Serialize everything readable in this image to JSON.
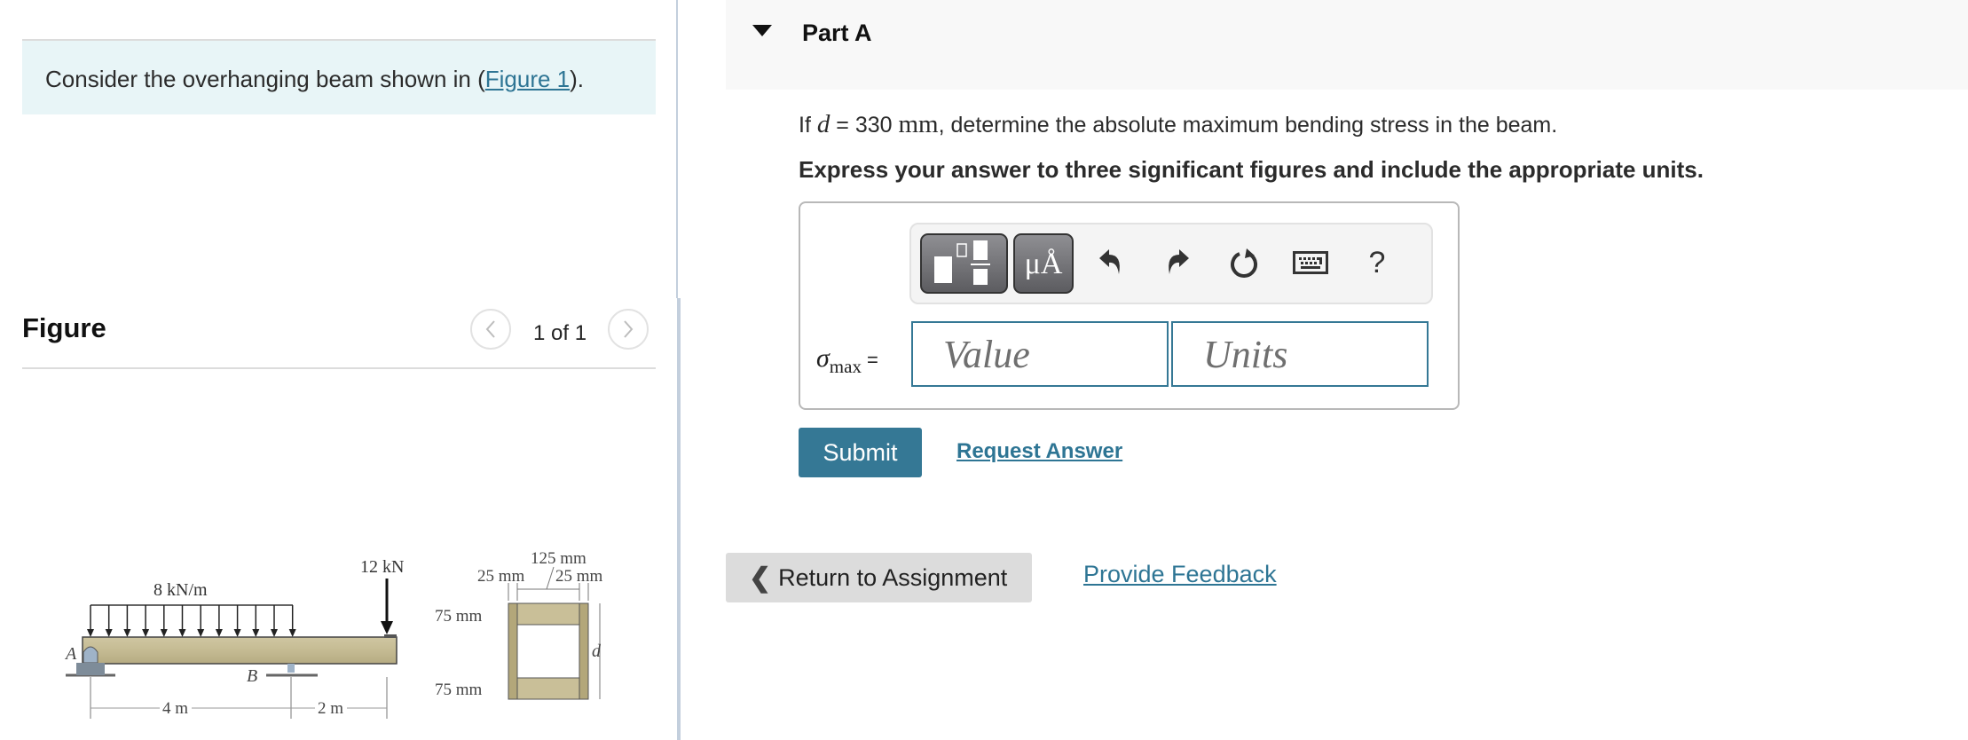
{
  "intro": {
    "prefix": "Consider the overhanging beam shown in (",
    "link_label": "Figure 1",
    "suffix": ")."
  },
  "figure_panel": {
    "title": "Figure",
    "pager_text": "1 of 1",
    "prev_icon": "chevron-left-icon",
    "next_icon": "chevron-right-icon"
  },
  "figure": {
    "distributed_load_label": "8 kN/m",
    "point_load_label": "12 kN",
    "support_a_label": "A",
    "support_b_label": "B",
    "span_ab_label": "4 m",
    "overhang_label": "2 m",
    "section": {
      "inner_width_label": "125 mm",
      "left_side_label": "25 mm",
      "right_side_label": "25 mm",
      "top_flange_label": "75 mm",
      "bottom_flange_label": "75 mm",
      "depth_label": "d"
    }
  },
  "part": {
    "title": "Part A",
    "question_prefix": "If ",
    "question_var": "d",
    "question_eq": " = 330 ",
    "question_unit": "mm",
    "question_suffix": ", determine the absolute maximum bending stress in the beam.",
    "instruction": "Express your answer to three significant figures and include the appropriate units."
  },
  "toolbar": {
    "templates_icon": "templates-icon",
    "units_label": "μÅ",
    "undo_icon": "undo-icon",
    "redo_icon": "redo-icon",
    "reset_icon": "reset-icon",
    "keyboard_icon": "keyboard-icon",
    "help_label": "?"
  },
  "answer": {
    "symbol": "σ",
    "subscript": "max",
    "equals": "=",
    "value_placeholder": "Value",
    "value": "",
    "units_placeholder": "Units",
    "units": ""
  },
  "actions": {
    "submit_label": "Submit",
    "request_answer_label": "Request Answer",
    "return_label": "Return to Assignment",
    "feedback_label": "Provide Feedback"
  },
  "colors": {
    "accent": "#357895",
    "link": "#2e7594",
    "intro_bg": "#e8f5f7",
    "header_bg": "#f8f8f8",
    "return_bg": "#dcdcdc"
  }
}
